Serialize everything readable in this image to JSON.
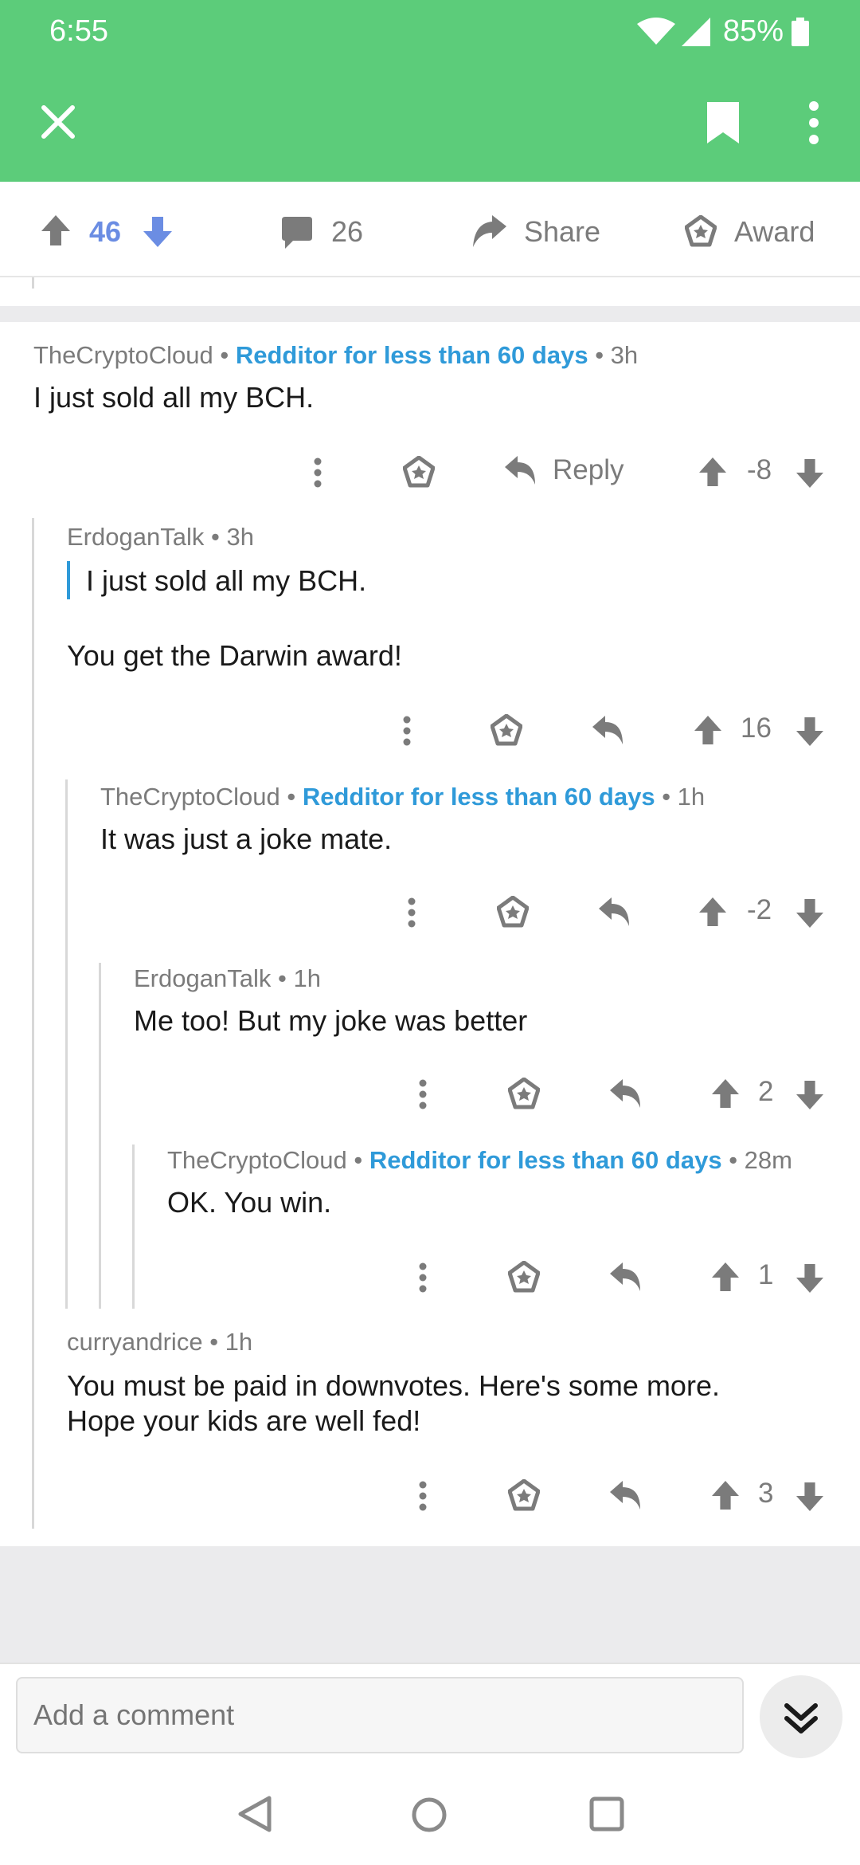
{
  "status": {
    "time": "6:55",
    "battery": "85%"
  },
  "actionbar": {
    "score": "46",
    "comments": "26",
    "share": "Share",
    "award": "Award"
  },
  "comments": [
    {
      "author": "TheCryptoCloud",
      "flair": "Redditor for less than 60 days",
      "age": "3h",
      "body": [
        "I just sold all my BCH."
      ],
      "reply_label": "Reply",
      "score": "-8"
    },
    {
      "author": "ErdoganTalk",
      "age": "3h",
      "quote": "I just sold all my BCH.",
      "body": [
        "You get the Darwin award!"
      ],
      "score": "16"
    },
    {
      "author": "TheCryptoCloud",
      "flair": "Redditor for less than 60 days",
      "age": "1h",
      "body": [
        "It was just a joke mate."
      ],
      "score": "-2"
    },
    {
      "author": "ErdoganTalk",
      "age": "1h",
      "body": [
        "Me too! But my joke was better"
      ],
      "score": "2"
    },
    {
      "author": "TheCryptoCloud",
      "flair": "Redditor for less than 60 days",
      "age": "28m",
      "body": [
        "OK. You win."
      ],
      "score": "1"
    },
    {
      "author": "curryandrice",
      "age": "1h",
      "body": [
        "You must be paid in downvotes. Here's some more.",
        "Hope your kids are well fed!"
      ],
      "score": "3"
    }
  ],
  "composer": {
    "placeholder": "Add a comment"
  },
  "separator": "•",
  "icons": [
    "close-icon",
    "bookmark-icon",
    "overflow-menu-icon",
    "upvote-icon",
    "downvote-icon",
    "comment-icon",
    "share-icon",
    "award-icon",
    "reply-icon",
    "collapse-down-icon",
    "nav-back-icon",
    "nav-home-icon",
    "nav-recents-icon"
  ],
  "colors": {
    "header": "#5ccc7a",
    "flair": "#2f9ad9",
    "upvoted": "#6b8de3"
  }
}
